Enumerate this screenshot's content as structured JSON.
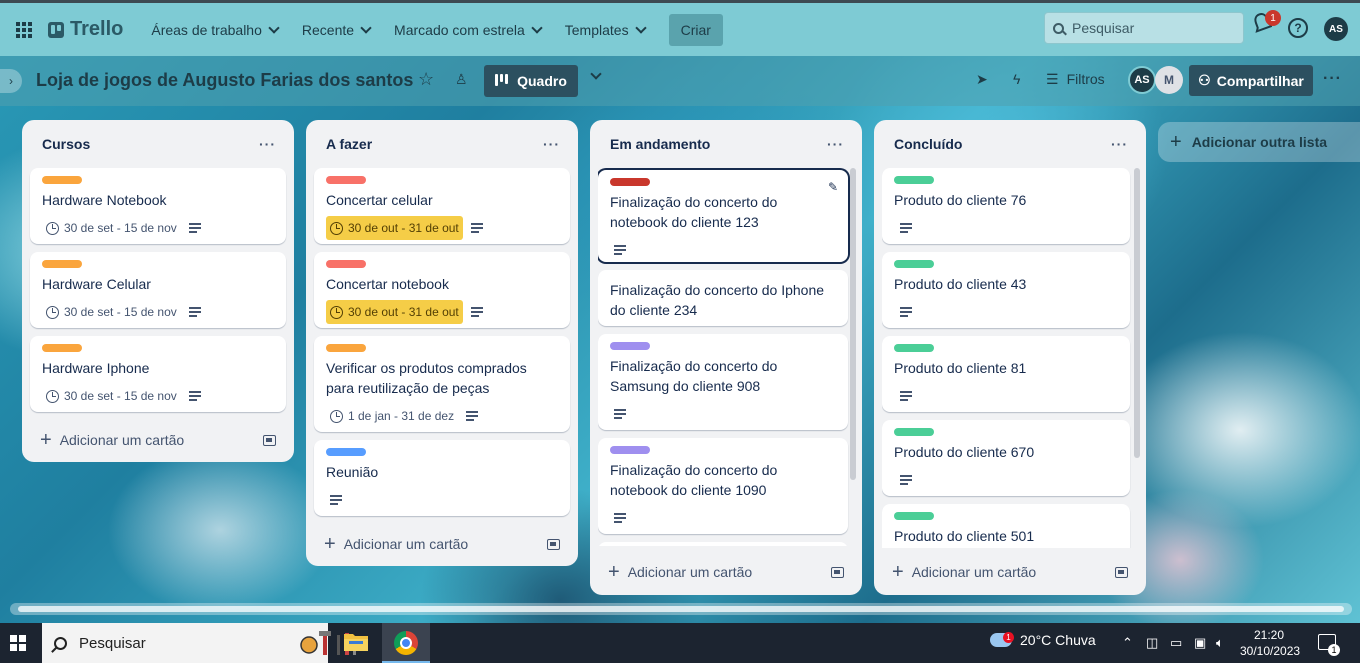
{
  "topbar": {
    "logo": "Trello",
    "nav": [
      "Áreas de trabalho",
      "Recente",
      "Marcado com estrela",
      "Templates"
    ],
    "create": "Criar",
    "search_placeholder": "Pesquisar",
    "notification_count": "1",
    "help": "?",
    "avatar": "AS"
  },
  "board": {
    "title": "Loja de jogos de Augusto Farias dos santos",
    "view": "Quadro",
    "filters": "Filtros",
    "members": [
      "AS",
      "M"
    ],
    "share": "Compartilhar",
    "add_list": "Adicionar outra lista"
  },
  "colors": {
    "orange": "#faa53d",
    "red": "#f87168",
    "dark_red": "#c9372c",
    "blue": "#579dff",
    "purple": "#9f8fef",
    "green": "#4bce97",
    "due": "#f5cd47"
  },
  "lists": [
    {
      "title": "Cursos",
      "add": "Adicionar um cartão",
      "cards": [
        {
          "title": "Hardware Notebook",
          "label": "orange",
          "date": "30 de set - 15 de nov"
        },
        {
          "title": "Hardware Celular",
          "label": "orange",
          "date": "30 de set - 15 de nov"
        },
        {
          "title": "Hardware Iphone",
          "label": "orange",
          "date": "30 de set - 15 de nov"
        }
      ]
    },
    {
      "title": "A fazer",
      "add": "Adicionar um cartão",
      "cards": [
        {
          "title": "Concertar celular",
          "label": "red",
          "date": "30 de out - 31 de out"
        },
        {
          "title": "Concertar notebook",
          "label": "red",
          "date": "30 de out - 31 de out"
        },
        {
          "title": "Verificar os produtos comprados para reutilização de peças",
          "label": "orange",
          "date": "1 de jan - 31 de dez"
        },
        {
          "title": "Reunião",
          "label": "blue"
        }
      ]
    },
    {
      "title": "Em andamento",
      "add": "Adicionar um cartão",
      "cards": [
        {
          "title": "Finalização do concerto do notebook do cliente 123",
          "label": "dark_red"
        },
        {
          "title": "Finalização do concerto do Iphone do cliente 234"
        },
        {
          "title": "Finalização do concerto do Samsung do cliente 908",
          "label": "purple"
        },
        {
          "title": "Finalização do concerto do notebook do cliente 1090",
          "label": "purple"
        }
      ]
    },
    {
      "title": "Concluído",
      "add": "Adicionar um cartão",
      "cards": [
        {
          "title": "Produto do cliente 76",
          "label": "green"
        },
        {
          "title": "Produto do cliente 43",
          "label": "green"
        },
        {
          "title": "Produto do cliente 81",
          "label": "green"
        },
        {
          "title": "Produto do cliente 670",
          "label": "green"
        },
        {
          "title": "Produto do cliente 501",
          "label": "green"
        }
      ]
    }
  ],
  "taskbar": {
    "search": "Pesquisar",
    "weather": "20°C  Chuva",
    "weather_badge": "1",
    "time": "21:20",
    "date": "30/10/2023",
    "notifications": "1"
  }
}
